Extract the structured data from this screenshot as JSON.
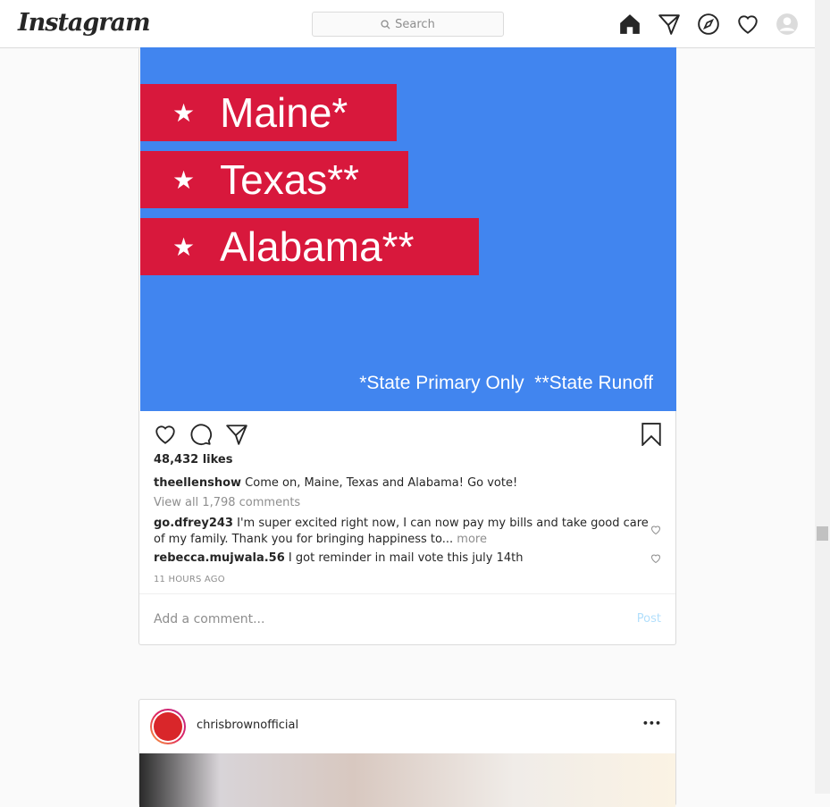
{
  "nav": {
    "logo": "Instagram",
    "search_placeholder": "Search",
    "icons": [
      "home-icon",
      "direct-icon",
      "explore-icon",
      "activity-heart-icon",
      "profile-avatar-icon"
    ]
  },
  "post1": {
    "image": {
      "banners": [
        "Maine*",
        "Texas**",
        "Alabama**"
      ],
      "footnote": "*State Primary Only  **State Runoff",
      "colors": {
        "background": "#4185ef",
        "banner": "#d8183c"
      }
    },
    "likes": "48,432 likes",
    "caption": {
      "user": "theellenshow",
      "text": "Come on, Maine, Texas and Alabama! Go vote!"
    },
    "view_all": "View all 1,798 comments",
    "comments": [
      {
        "user": "go.dfrey243",
        "text": "I'm super excited right now, I can now pay my bills and take good care of my family. Thank you for bringing happiness to...",
        "more": "more"
      },
      {
        "user": "rebecca.mujwala.56",
        "text": "I got reminder in mail vote this july 14th"
      }
    ],
    "time": "11 HOURS AGO",
    "add_comment_placeholder": "Add a comment...",
    "post_label": "Post"
  },
  "post2": {
    "user": "chrisbrownofficial",
    "more_label": "•••"
  }
}
